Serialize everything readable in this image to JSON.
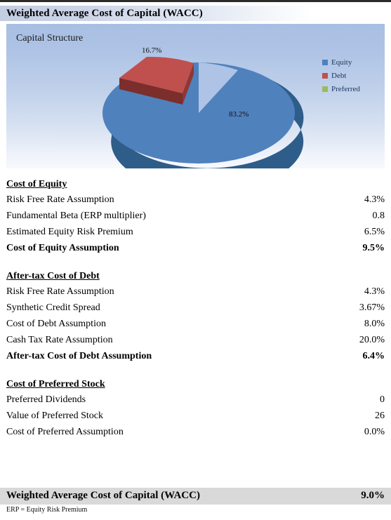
{
  "header": {
    "title": "Weighted Average Cost of Capital (WACC)"
  },
  "chart_panel": {
    "title": "Capital Structure",
    "legend": [
      {
        "label": "Equity",
        "color": "#4f81bd"
      },
      {
        "label": "Debt",
        "color": "#c0504d"
      },
      {
        "label": "Preferred",
        "color": "#9bbb59"
      }
    ]
  },
  "chart_data": {
    "type": "pie",
    "title": "Capital Structure",
    "categories": [
      "Equity",
      "Debt",
      "Preferred"
    ],
    "values": [
      83.2,
      16.7,
      0.0
    ],
    "data_labels": [
      "83.2%",
      "16.7%",
      ""
    ],
    "colors": [
      "#4f81bd",
      "#c0504d",
      "#9bbb59"
    ],
    "legend_position": "right",
    "exploded": [
      "Debt"
    ],
    "three_d": true,
    "grid": false
  },
  "sections": [
    {
      "heading": "Cost of Equity",
      "rows": [
        {
          "label": "Risk Free Rate Assumption",
          "value": "4.3%",
          "bold": false
        },
        {
          "label": "Fundamental Beta (ERP multiplier)",
          "value": "0.8",
          "bold": false
        },
        {
          "label": "Estimated Equity Risk Premium",
          "value": "6.5%",
          "bold": false
        },
        {
          "label": "Cost of Equity Assumption",
          "value": "9.5%",
          "bold": true
        }
      ]
    },
    {
      "heading": "After-tax Cost of Debt",
      "rows": [
        {
          "label": "Risk Free Rate Assumption",
          "value": "4.3%",
          "bold": false
        },
        {
          "label": "Synthetic Credit Spread",
          "value": "3.67%",
          "bold": false
        },
        {
          "label": "Cost of Debt Assumption",
          "value": "8.0%",
          "bold": false
        },
        {
          "label": "Cash Tax Rate Assumption",
          "value": "20.0%",
          "bold": false
        },
        {
          "label": "After-tax Cost of Debt Assumption",
          "value": "6.4%",
          "bold": true
        }
      ]
    },
    {
      "heading": "Cost of Preferred Stock",
      "rows": [
        {
          "label": "Preferred Dividends",
          "value": "0",
          "bold": false
        },
        {
          "label": "Value of Preferred Stock",
          "value": "26",
          "bold": false
        },
        {
          "label": "Cost of Preferred Assumption",
          "value": "0.0%",
          "bold": false
        }
      ]
    }
  ],
  "footer": {
    "wacc_label": "Weighted Average Cost of Capital (WACC)",
    "wacc_value": "9.0%",
    "footnote": "ERP = Equity Risk Premium"
  }
}
